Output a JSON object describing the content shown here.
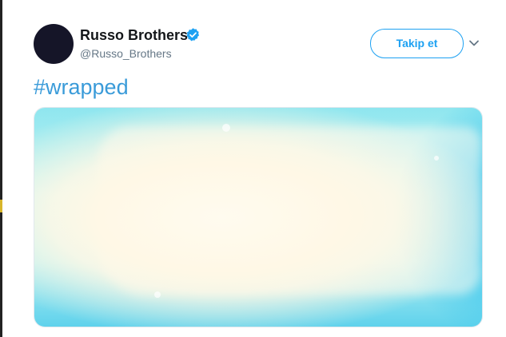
{
  "tweet": {
    "author": {
      "display_name": "Russo Brothers",
      "handle": "@Russo_Brothers",
      "verified": true
    },
    "follow_button_label": "Takip et",
    "text": "#wrapped",
    "media": {
      "kind": "image",
      "description_colors": {
        "center": "#fffbef",
        "edge": "#8fe6ef",
        "accent": "#20b6ec"
      }
    }
  },
  "colors": {
    "accent": "#1da1f2",
    "hashtag": "#3a9bd9",
    "name": "#14171a",
    "handle": "#657786",
    "avatar": "#151528"
  },
  "icons": {
    "verified": "verified-badge-icon",
    "menu": "chevron-down-icon"
  }
}
